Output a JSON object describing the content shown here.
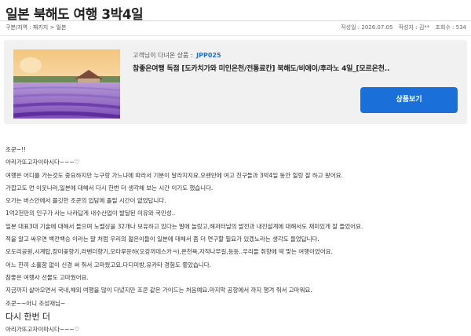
{
  "post": {
    "title": "일본 북해도 여행 3박4일",
    "breadcrumb": "구분/지역 : 패키지 > 일본",
    "date_label": "작성일 : 2026.07.05",
    "author_label": "작성자 : 김**",
    "views_label": "조회수 : 534"
  },
  "product": {
    "code_label": "고객님이 다녀온 상품 :",
    "code": "JPP025",
    "name": "참좋은여행 독점 [도카치가와 미인온천/전통료칸] 북해도/비에이/후라노 4일_[모르온천..",
    "button_label": "상품보기"
  },
  "review_lines": [
    " 조쿤~!!",
    "아리가또고자이마시다~~~♡",
    "여행은 어디를 가는것도 중요하지만 누구랑 가느냐에 따라서 기분이 달라지지요.오랜만에 여고 친구들과 3박4일 동안 힐링 잘 하고 왔어요.",
    "가깝고도 먼 이웃나라,일본에 대해서 다시 한번 더 생각해 보는 시간 이기도 했습니다.",
    "오가는 버스안에서 쫄깃한 조쿤의 입담에 졸릴 시간이 없었답니다.",
    "1억2천만의 인구가 사는 나라답게 내수산업이 발달된 이유와 국민성..",
    "일본 대표3대 기술에 대해서 들으며 노벨상을 32개나 보유하고 있다는 말에 놀랐고,해저터널의 발전과 내진설계에 대해서도 재미있게 잘 들었어요.",
    "적을 알고 싸우면 백전백승 이라는 말 처럼 우리의 젊은이들이 일본에 대해서 좀 더 연구할 필요가 있겠노라는 생각도 들었답니다.",
    "오도리공원,시계탑,장미꽃향기,라벤더향기,오타루운하(오강끼데스카ㅋ),온천욕,자작나무길,등등..우리들 취향에 딱 맞는 여행이었어요.",
    "어느 한끼 소홀함 없이 신경 써 줘서 고마웠고요.다디미방,유카타 경험도 좋았습니다.",
    "참좋은 여행사 선물도 고마웠어요.",
    "지금까지 살아오면서 국내,해외 여행을 많이 다녔지만 조쿤 같은 가이드는 처음예요.마지막 공항에서 까지 챙겨 줘서 고마워요.",
    "조쿤~~아니 조성재님~",
    "다시 한번 더",
    "아리가또고자이마시다~~~♡"
  ],
  "colors": {
    "accent": "#1a6fd8",
    "card_bg": "#f1f1f1"
  },
  "thumbnail_icon": "lavender-field-photo"
}
